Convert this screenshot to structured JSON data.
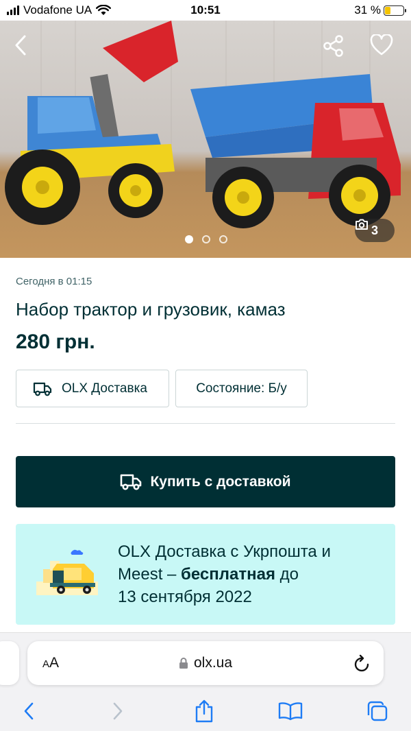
{
  "status_bar": {
    "carrier": "Vodafone UA",
    "time": "10:51",
    "battery": "31 %",
    "battery_level": 0.31
  },
  "gallery": {
    "photo_count": "3",
    "total_images": 3,
    "active_index": 0
  },
  "listing": {
    "date": "Сегодня в 01:15",
    "title": "Набор трактор и грузовик, камаз",
    "price": "280 грн.",
    "delivery_chip": "OLX Доставка",
    "state_chip": "Состояние: Б/у",
    "buy_button": "Купить с доставкой"
  },
  "promo": {
    "line1": "OLX Доставка с Укрпошта и",
    "line2_prefix": "Meest – ",
    "line2_bold": "бесплатная",
    "line2_suffix": " до",
    "line3": "13 сентября 2022"
  },
  "browser": {
    "aa_label_small": "A",
    "aa_label_large": "A",
    "url": "olx.ua"
  },
  "colors": {
    "brand_dark": "#002f34",
    "promo_bg": "#c8f8f6",
    "text_muted": "#406367"
  }
}
